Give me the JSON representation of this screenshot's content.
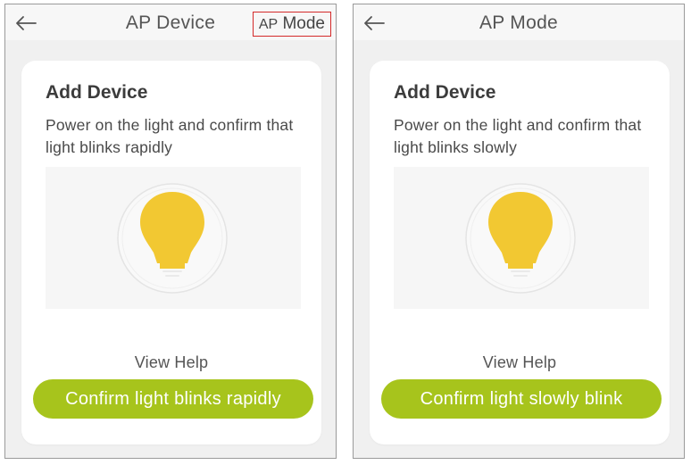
{
  "colors": {
    "accent": "#a7c41c",
    "highlight_box": "#d42a2a",
    "bulb": "#f2c832"
  },
  "screens": [
    {
      "header": {
        "title": "AP Device",
        "mode_prefix": "AP",
        "mode_label": "Mode",
        "back_icon": "arrow-left-icon"
      },
      "card": {
        "title": "Add Device",
        "description": "Power on the light and confirm that light blinks rapidly",
        "illustration": "light-bulb-icon",
        "help_link": "View Help",
        "confirm_label": "Confirm light blinks rapidly"
      }
    },
    {
      "header": {
        "title": "AP Mode",
        "back_icon": "arrow-left-icon"
      },
      "card": {
        "title": "Add Device",
        "description": "Power on the light and confirm that light blinks slowly",
        "illustration": "light-bulb-icon",
        "help_link": "View Help",
        "confirm_label": "Confirm light slowly blink"
      }
    }
  ]
}
